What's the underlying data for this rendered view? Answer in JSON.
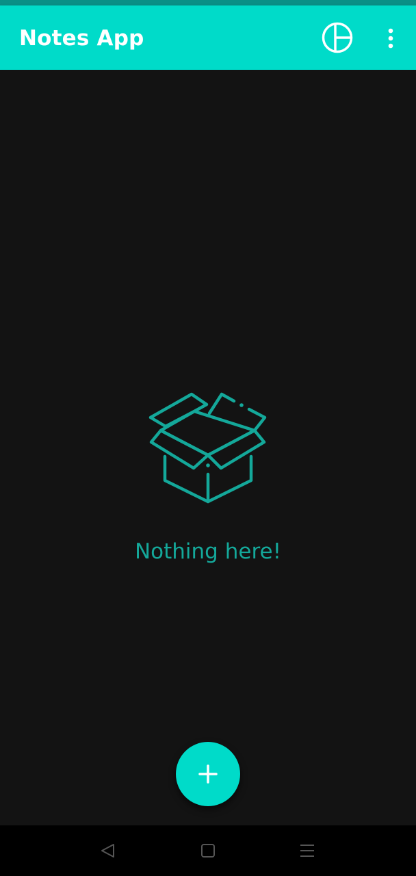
{
  "app_bar": {
    "title": "Notes App",
    "actions": [
      {
        "icon": "pie-chart-icon"
      },
      {
        "icon": "more-vertical-icon"
      }
    ]
  },
  "empty_state": {
    "icon": "open-box-icon",
    "message": "Nothing here!"
  },
  "fab": {
    "icon": "plus-icon"
  },
  "system_nav": {
    "buttons": [
      "back-icon",
      "home-icon",
      "recents-icon"
    ]
  },
  "colors": {
    "accent": "#00dbc9",
    "accent_dark": "#0a8f86",
    "empty_accent": "#14a89a",
    "background": "#131313",
    "nav_background": "#000000"
  }
}
